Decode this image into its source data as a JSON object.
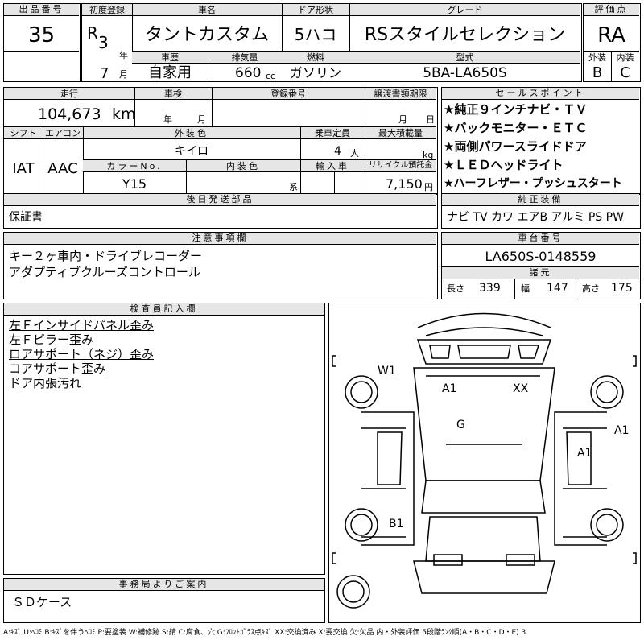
{
  "header": {
    "lot_label": "出品番号",
    "lot_value": "35",
    "first_reg_label": "初度登録",
    "era": "R",
    "year_num": "3",
    "year_unit": "年",
    "month_num": "7",
    "month_unit": "月",
    "name_label": "車名",
    "name_value": "タントカスタム",
    "door_label": "ドア形状",
    "door_value": "5ハコ",
    "grade_label": "グレード",
    "grade_value": "RSスタイルセレクション",
    "score_label": "評価点",
    "score_value": "RA",
    "history_label": "車歴",
    "history_value": "自家用",
    "disp_label": "排気量",
    "disp_value": "660",
    "disp_unit": "cc",
    "fuel_label": "燃料",
    "fuel_value": "ガソリン",
    "model_label": "型式",
    "model_value": "5BA-LA650S",
    "ext_grade_label": "外装",
    "int_grade_label": "内装",
    "ext_grade": "B",
    "int_grade": "C"
  },
  "row2": {
    "mileage_label": "走行",
    "mileage_value": "104,673",
    "mileage_unit": "km",
    "inspection_label": "車検",
    "insp_year": "年",
    "insp_month": "月",
    "regno_label": "登録番号",
    "transfer_label": "譲渡書類期限",
    "transfer_month": "月",
    "transfer_day": "日",
    "shift_label": "シフト",
    "shift_value": "IAT",
    "ac_label": "エアコン",
    "ac_value": "AAC",
    "color_label": "外装色",
    "color_value": "キイロ",
    "capacity_label": "乗車定員",
    "capacity_value": "4",
    "capacity_unit": "人",
    "load_label": "最大積載量",
    "load_unit": "kg",
    "colorno_label": "カラーNo.",
    "colorno_value": "Y15",
    "intcolor_label": "内装色",
    "intcolor_unit": "系",
    "import_label": "輸入車",
    "recycle_label": "リサイクル預託金",
    "recycle_value": "7,150",
    "recycle_unit": "円"
  },
  "sales_points": {
    "label": "セールスポイント",
    "items": [
      "★純正９インチナビ・ＴＶ",
      "★バックモニター・ＥＴＣ",
      "★両側パワースライドドア",
      "★ＬＥＤヘッドライト",
      "★ハーフレザー・プッシュスタート"
    ]
  },
  "later_parts": {
    "label": "後日発送部品",
    "value": "保証書"
  },
  "equipment": {
    "label": "純正装備",
    "value": "ナビ TV カワ エアB アルミ PS PW"
  },
  "notes": {
    "label": "注意事項欄",
    "lines": [
      "キー２ヶ車内・ドライブレコーダー",
      "アダプティブクルーズコントロール"
    ]
  },
  "chassis": {
    "label": "車台番号",
    "value": "LA650S-0148559"
  },
  "specs": {
    "label": "諸元",
    "length_label": "長さ",
    "length_value": "339",
    "width_label": "幅",
    "width_value": "147",
    "height_label": "高さ",
    "height_value": "175"
  },
  "inspector": {
    "label": "検査員記入欄",
    "lines": [
      "左Ｆインサイドパネル歪み",
      "左Ｆピラー歪み",
      "ロアサポート（ネジ）歪み",
      "コアサポート歪み",
      "ドア内張汚れ"
    ]
  },
  "diagram": {
    "marks": {
      "w1": "W1",
      "a1_top": "A1",
      "xx": "XX",
      "g": "G",
      "a1_right": "A1",
      "a1_side": "A1",
      "b1": "B1"
    }
  },
  "office": {
    "label": "事務局よりご案内",
    "value": "ＳＤケース"
  },
  "legend": "A:ｷｽﾞ U:ﾍｺﾐ B:ｷｽﾞを伴うﾍｺﾐ P:要塗装 W:補修跡 S:錆 C:腐食、穴 G:ﾌﾛﾝﾄｶﾞﾗｽ点ｷｽﾞ XX:交換済み X:要交換 欠:欠品 内・外装評価 5段階ﾗﾝｸ順(A・B・C・D・E) 3"
}
